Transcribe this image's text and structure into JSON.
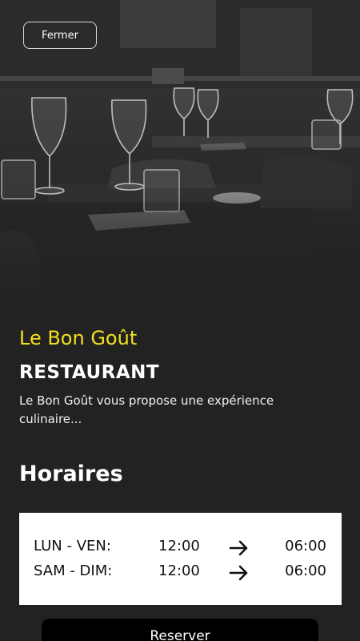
{
  "header": {
    "close_label": "Fermer"
  },
  "restaurant": {
    "name": "Le Bon Goût",
    "type": "RESTAURANT",
    "description": "Le Bon Goût vous propose une expérience culinaire..."
  },
  "hours": {
    "title": "Horaires",
    "rows": [
      {
        "days": "LUN - VEN:",
        "open": "12:00",
        "close": "06:00"
      },
      {
        "days": "SAM - DIM:",
        "open": "12:00",
        "close": "06:00"
      }
    ]
  },
  "actions": {
    "reserve_label": "Reserver"
  },
  "colors": {
    "accent": "#f2e01f",
    "background": "#222222",
    "card": "#ffffff",
    "button": "#000000"
  },
  "icons": {
    "hero": "restaurant-interior-photo",
    "arrow": "arrow-right-icon"
  }
}
